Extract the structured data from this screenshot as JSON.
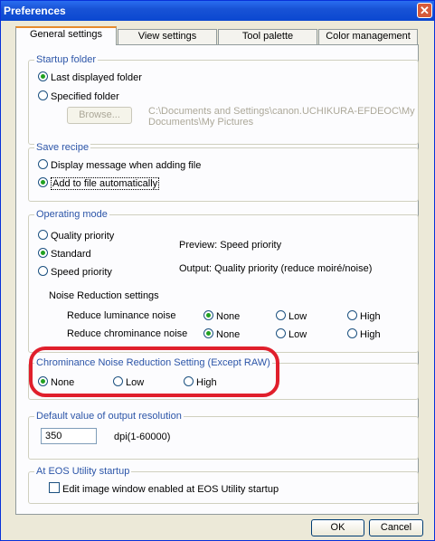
{
  "window": {
    "title": "Preferences",
    "close_icon": "close-icon"
  },
  "tabs": [
    {
      "label": "General settings",
      "active": true
    },
    {
      "label": "View settings",
      "active": false
    },
    {
      "label": "Tool palette",
      "active": false
    },
    {
      "label": "Color management",
      "active": false
    }
  ],
  "startup_folder": {
    "title": "Startup folder",
    "last_displayed": "Last displayed folder",
    "specified": "Specified folder",
    "browse": "Browse...",
    "path": "C:\\Documents and Settings\\canon.UCHIKURA-EFDEOC\\My Documents\\My Pictures"
  },
  "save_recipe": {
    "title": "Save recipe",
    "display_message": "Display message when adding file",
    "add_auto": "Add to file automatically"
  },
  "operating_mode": {
    "title": "Operating mode",
    "quality": "Quality priority",
    "standard": "Standard",
    "speed": "Speed priority",
    "preview": "Preview: Speed priority",
    "output": "Output: Quality priority (reduce moiré/noise)",
    "nr_settings": "Noise Reduction settings",
    "luminance": "Reduce luminance noise",
    "chrominance": "Reduce chrominance noise",
    "none": "None",
    "low": "Low",
    "high": "High"
  },
  "chroma_nr": {
    "title": "Chrominance Noise Reduction Setting (Except RAW)",
    "none": "None",
    "low": "Low",
    "high": "High"
  },
  "output_resolution": {
    "title": "Default value of output resolution",
    "value": "350",
    "unit": "dpi(1-60000)"
  },
  "eos_startup": {
    "title": "At EOS Utility startup",
    "edit_window": "Edit image window enabled at EOS Utility startup"
  },
  "footer": {
    "ok": "OK",
    "cancel": "Cancel"
  },
  "colors": {
    "highlight": "#e01f2c",
    "titlebar": "#0b47d0",
    "group_title": "#2c55a8"
  }
}
